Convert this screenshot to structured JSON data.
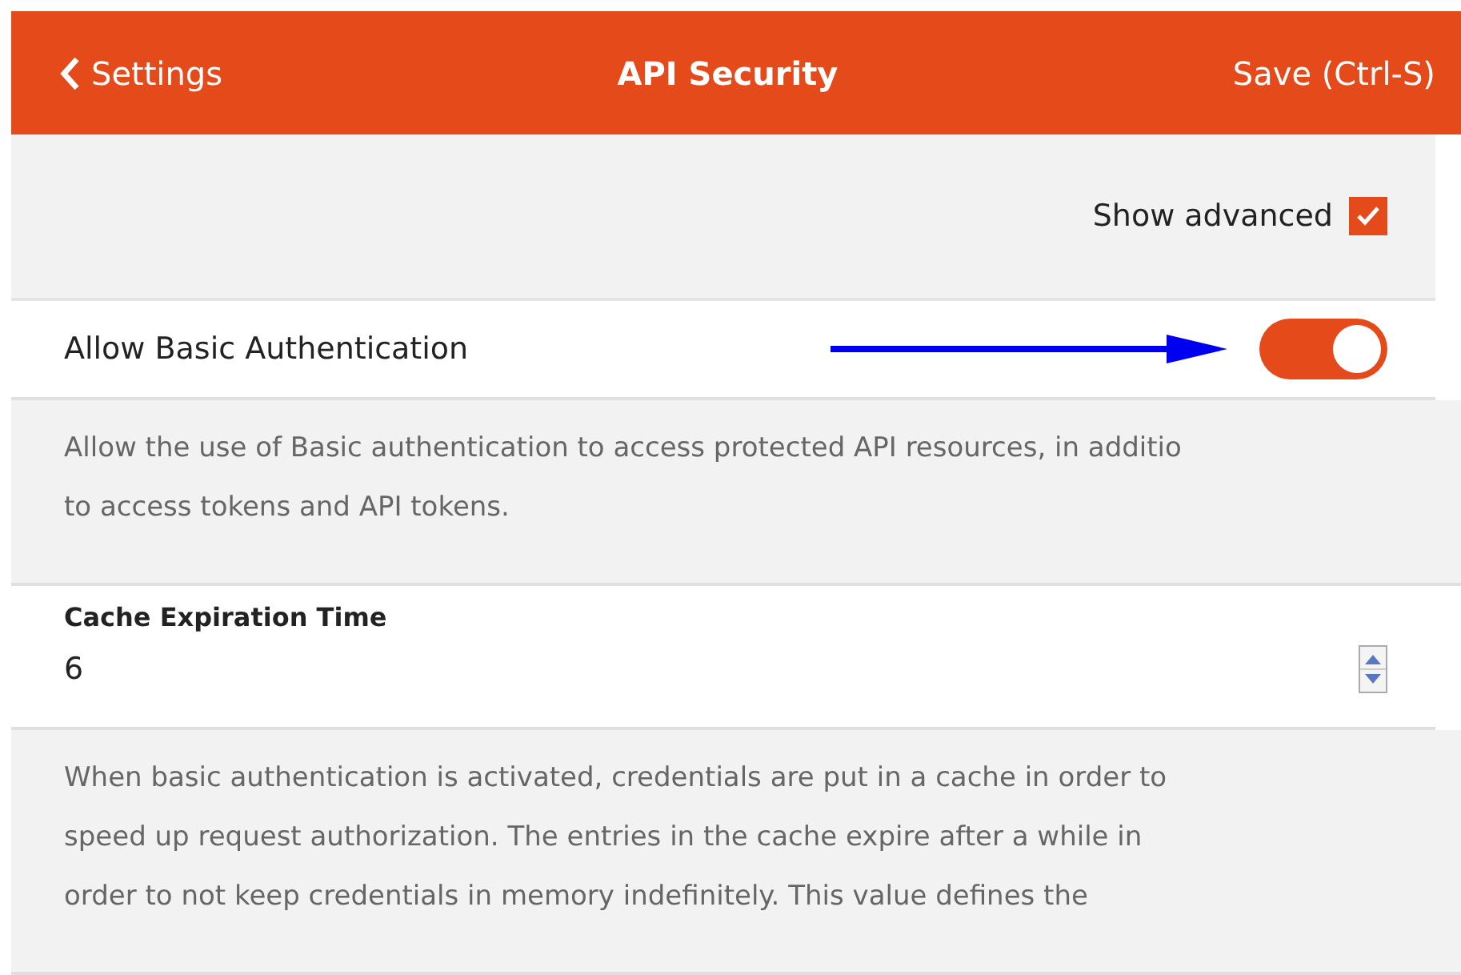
{
  "header": {
    "back": "Settings",
    "title": "API Security",
    "save": "Save (Ctrl-S)"
  },
  "toolbar": {
    "label": "Show advanced",
    "checked": true
  },
  "basic_auth": {
    "label": "Allow Basic Authentication",
    "on": true,
    "description_lines": [
      "Allow the use of Basic authentication to access protected API resources, in additio",
      "to access tokens and API tokens."
    ]
  },
  "cache": {
    "label": "Cache Expiration Time",
    "value": "6",
    "description_lines": [
      "When basic authentication is activated, credentials are put in a cache in order to",
      "speed up request authorization. The entries in the cache expire after a while in",
      "order to not keep credentials in memory indefinitely. This value defines the"
    ]
  }
}
